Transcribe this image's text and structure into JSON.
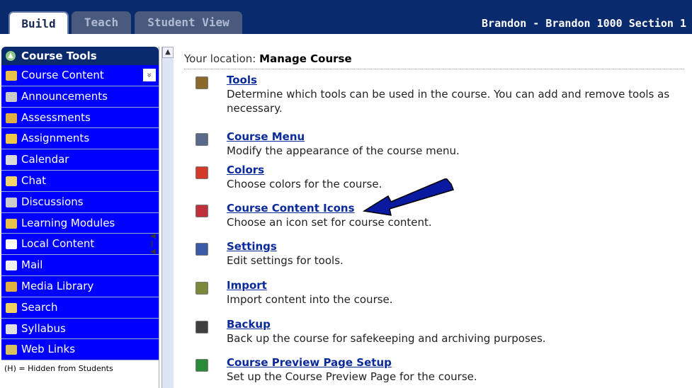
{
  "tabs": [
    {
      "label": "Build",
      "active": true
    },
    {
      "label": "Teach",
      "active": false
    },
    {
      "label": "Student View",
      "active": false
    }
  ],
  "course_title": "Brandon - Brandon 1000 Section 1",
  "sidebar": {
    "header": "Course Tools",
    "items": [
      {
        "label": "Course Content",
        "icon": "house-icon"
      },
      {
        "label": "Announcements",
        "icon": "megaphone-icon"
      },
      {
        "label": "Assessments",
        "icon": "assessment-icon"
      },
      {
        "label": "Assignments",
        "icon": "assignment-icon"
      },
      {
        "label": "Calendar",
        "icon": "calendar-icon"
      },
      {
        "label": "Chat",
        "icon": "chat-icon"
      },
      {
        "label": "Discussions",
        "icon": "discussion-icon"
      },
      {
        "label": "Learning Modules",
        "icon": "module-icon"
      },
      {
        "label": "Local Content",
        "icon": "disc-icon"
      },
      {
        "label": "Mail",
        "icon": "mail-icon"
      },
      {
        "label": "Media Library",
        "icon": "media-icon"
      },
      {
        "label": "Search",
        "icon": "search-icon"
      },
      {
        "label": "Syllabus",
        "icon": "syllabus-icon"
      },
      {
        "label": "Web Links",
        "icon": "globe-icon"
      }
    ],
    "footer": "(H) = Hidden from Students"
  },
  "location": {
    "prefix": "Your location:",
    "value": "Manage Course"
  },
  "tools": [
    {
      "title": "Tools",
      "desc": "Determine which tools can be used in the course. You can add and remove tools as necessary.",
      "color": "#8a6a2a"
    },
    {
      "title": "Course Menu",
      "desc": "Modify the appearance of the course menu.",
      "color": "#5a6a8a"
    },
    {
      "title": "Colors",
      "desc": "Choose colors for the course.",
      "color": "#d43a2a"
    },
    {
      "title": "Course Content Icons",
      "desc": "Choose an icon set for course content.",
      "color": "#c0303a"
    },
    {
      "title": "Settings",
      "desc": "Edit settings for tools.",
      "color": "#3a5aa8"
    },
    {
      "title": "Import",
      "desc": "Import content into the course.",
      "color": "#7a8a3a"
    },
    {
      "title": "Backup",
      "desc": "Back up the course for safekeeping and archiving purposes.",
      "color": "#404040"
    },
    {
      "title": "Course Preview Page Setup",
      "desc": "Set up the Course Preview Page for the course.",
      "color": "#2a8a3a"
    }
  ],
  "colors": {
    "navy": "#0a2a6e",
    "sidebar_blue": "#0000ff",
    "link": "#0a2a9a"
  }
}
